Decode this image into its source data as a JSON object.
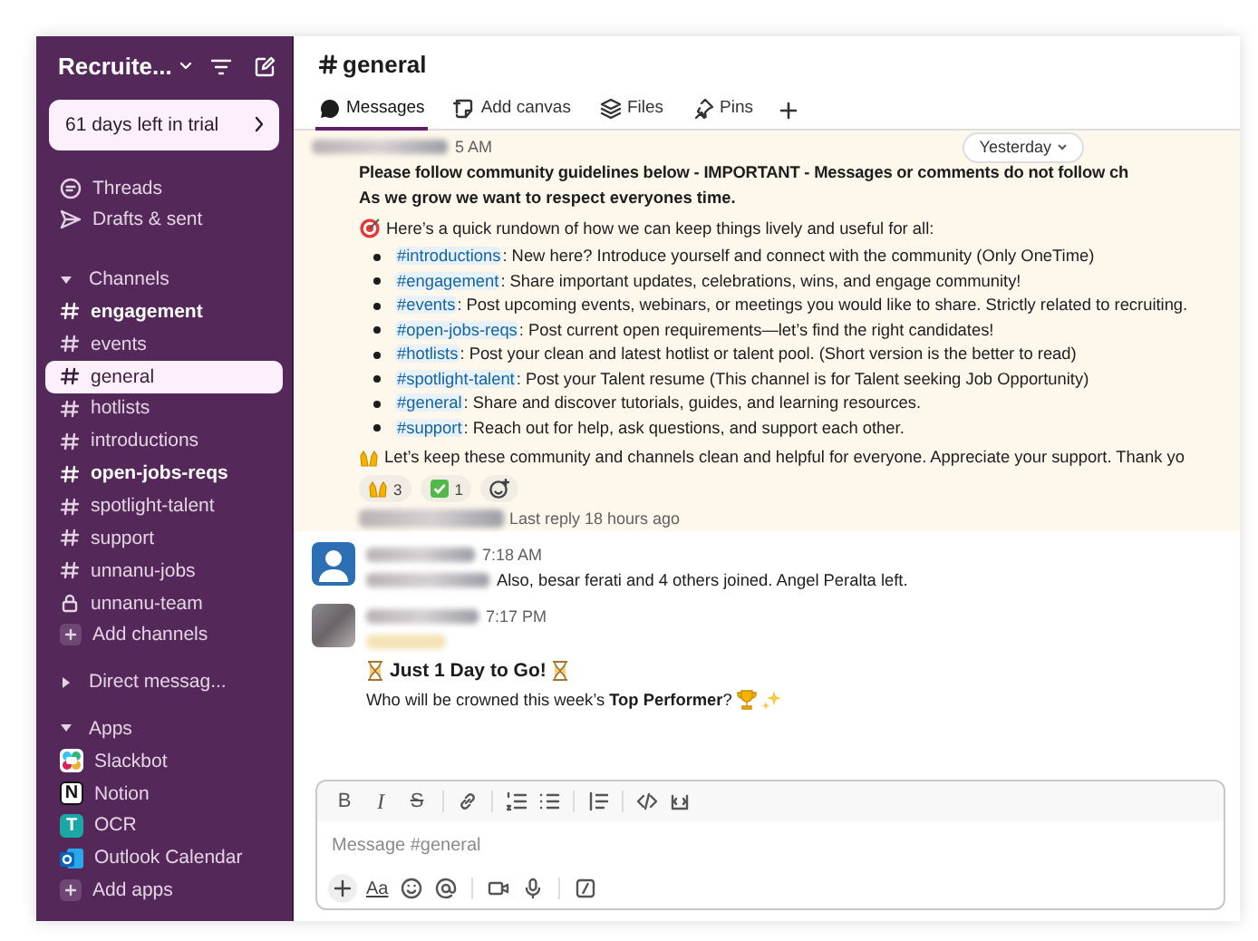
{
  "workspace": {
    "name": "Recruite..."
  },
  "trial_banner": {
    "text": "61 days left in trial"
  },
  "sidebar": {
    "nav": [
      {
        "label": "Threads"
      },
      {
        "label": "Drafts & sent"
      }
    ],
    "sections": [
      {
        "title": "Channels",
        "expanded": true,
        "add_label": "Add channels",
        "items": [
          {
            "label": "engagement",
            "kind": "public",
            "unread": true,
            "selected": false
          },
          {
            "label": "events",
            "kind": "public",
            "unread": false,
            "selected": false
          },
          {
            "label": "general",
            "kind": "public",
            "unread": false,
            "selected": true
          },
          {
            "label": "hotlists",
            "kind": "public",
            "unread": false,
            "selected": false
          },
          {
            "label": "introductions",
            "kind": "public",
            "unread": false,
            "selected": false
          },
          {
            "label": "open-jobs-reqs",
            "kind": "public",
            "unread": true,
            "selected": false
          },
          {
            "label": "spotlight-talent",
            "kind": "public",
            "unread": false,
            "selected": false
          },
          {
            "label": "support",
            "kind": "public",
            "unread": false,
            "selected": false
          },
          {
            "label": "unnanu-jobs",
            "kind": "public",
            "unread": false,
            "selected": false
          },
          {
            "label": "unnanu-team",
            "kind": "private",
            "unread": false,
            "selected": false
          }
        ]
      },
      {
        "title": "Direct messag...",
        "expanded": false
      },
      {
        "title": "Apps",
        "expanded": true,
        "add_label": "Add apps",
        "items": [
          {
            "label": "Slackbot",
            "kind": "slackbot",
            "unread": false,
            "selected": false
          },
          {
            "label": "Notion",
            "kind": "letter",
            "logo_text": "N",
            "color": "#111111",
            "unread": false,
            "selected": false
          },
          {
            "label": "OCR",
            "kind": "letter",
            "logo_text": "T",
            "color": "#1ba7a5",
            "unread": false,
            "selected": false
          },
          {
            "label": "Outlook Calendar",
            "kind": "outlook",
            "unread": false,
            "selected": false
          }
        ]
      }
    ]
  },
  "channel": {
    "title": "general"
  },
  "tabs": [
    {
      "label": "Messages",
      "selected": true
    },
    {
      "label": "Add canvas",
      "selected": false
    },
    {
      "label": "Files",
      "selected": false
    },
    {
      "label": "Pins",
      "selected": false
    }
  ],
  "messages": [
    {
      "kind": "pinned",
      "time": "5 AM",
      "date_pill": "Yesterday",
      "headline": "Please follow community guidelines below - IMPORTANT - Messages or comments do not follow ch",
      "subhead": "As we grow we want to respect everyones time.",
      "intro": "Here’s a quick rundown of how we can keep things lively and useful for all:",
      "bullets": [
        {
          "channel": "#introductions",
          "text": ": New here? Introduce yourself and connect with the community (Only OneTime)"
        },
        {
          "channel": "#engagement",
          "text": ": Share important updates, celebrations, wins, and engage community!"
        },
        {
          "channel": "#events",
          "text": ": Post upcoming events, webinars, or meetings you would like to share. Strictly related to recruiting."
        },
        {
          "channel": "#open-jobs-reqs",
          "text": ": Post current open requirements—let’s find the right candidates!"
        },
        {
          "channel": "#hotlists",
          "text": ": Post your clean and latest hotlist or talent pool. (Short version is the better to read)"
        },
        {
          "channel": "#spotlight-talent",
          "text": ": Post your Talent resume (This channel is for Talent seeking Job Opportunity)"
        },
        {
          "channel": "#general",
          "text": ": Share and discover tutorials, guides, and learning resources."
        },
        {
          "channel": "#support",
          "text": ": Reach out for help, ask questions, and support each other."
        }
      ],
      "closing": "Let’s keep these community and channels clean and helpful for everyone. Appreciate your support. Thank yo",
      "reactions": [
        {
          "kind": "hands",
          "count": "3"
        },
        {
          "kind": "check",
          "count": "1"
        }
      ],
      "thread": "Last reply 18 hours ago"
    },
    {
      "kind": "system",
      "time": "7:18 AM",
      "text": "Also, besar ferati and 4 others joined. Angel Peralta left."
    },
    {
      "kind": "post",
      "time": "7:17 PM",
      "title": "Just 1 Day to Go!",
      "text": "Who will be crowned this week’s **Top Performer**?"
    }
  ],
  "composer": {
    "format_buttons": [
      "B",
      "I",
      "S"
    ],
    "placeholder": "Message #general",
    "text_button": "Aa"
  }
}
